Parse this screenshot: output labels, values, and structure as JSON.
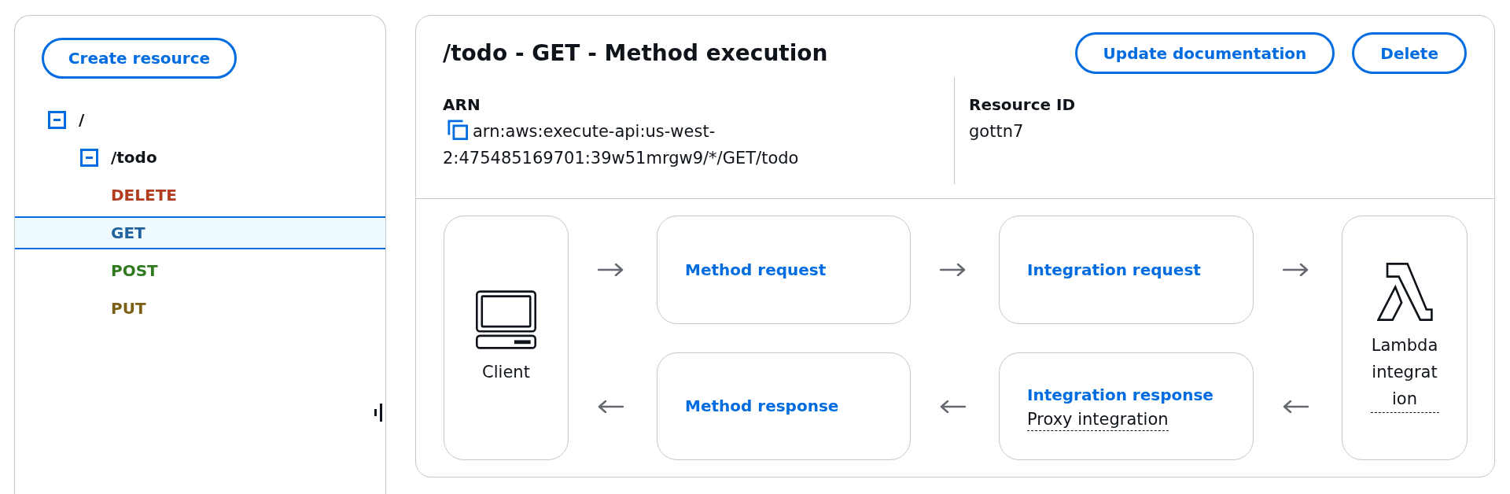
{
  "sidebar": {
    "create_button": {
      "label": "Create resource"
    },
    "resource_tree": [
      {
        "kind": "resource",
        "label": "/",
        "expanded": true,
        "selected": false,
        "children": [
          {
            "kind": "resource",
            "label": "/todo",
            "expanded": true,
            "selected": false,
            "children": [
              {
                "kind": "method",
                "label": "DELETE",
                "color": "#b33b1e",
                "selected": false
              },
              {
                "kind": "method",
                "label": "GET",
                "color": "#21639f",
                "selected": true
              },
              {
                "kind": "method",
                "label": "POST",
                "color": "#2f7a1f",
                "selected": false
              },
              {
                "kind": "method",
                "label": "PUT",
                "color": "#7b5f14",
                "selected": false
              }
            ]
          }
        ]
      }
    ]
  },
  "method_header": {
    "title": "/todo - GET - Method execution",
    "buttons": [
      "Update documentation",
      "Delete"
    ],
    "details": [
      {
        "label": "ARN",
        "value": "arn:aws:execute-api:us-west-2:475485169701:39w51mrgw9/*/GET/todo",
        "copyable": true
      },
      {
        "label": "Resource ID",
        "value": "gottn7",
        "copyable": false
      }
    ]
  },
  "execution_flow": {
    "client": {
      "label": "Client"
    },
    "request_steps": [
      {
        "label": "Method request"
      },
      {
        "label": "Integration request"
      }
    ],
    "response_steps": [
      {
        "label": "Method response"
      },
      {
        "label": "Integration response",
        "detail": "Proxy integration"
      }
    ],
    "integration": {
      "label": "Lambda integration"
    }
  }
}
